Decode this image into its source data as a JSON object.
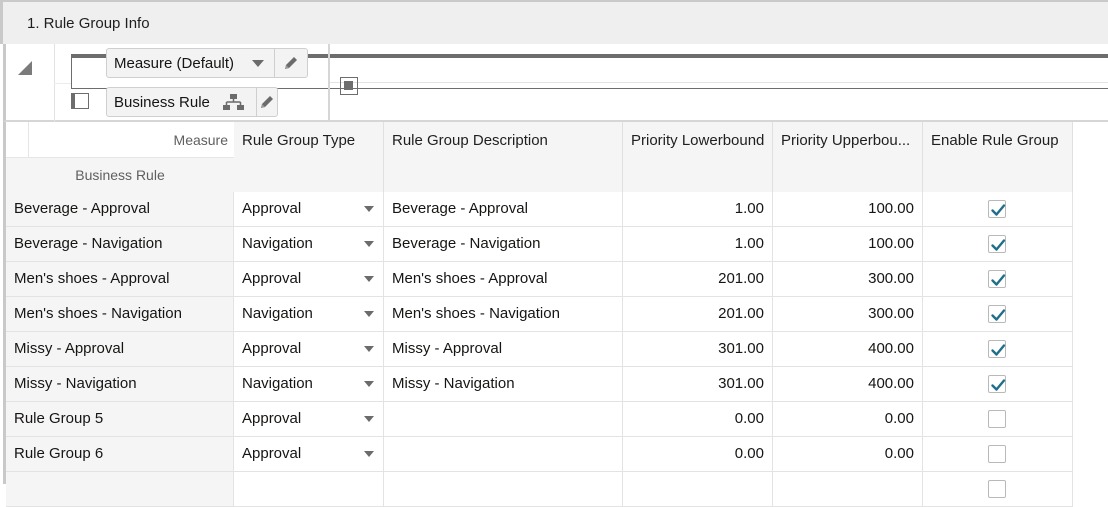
{
  "panel": {
    "title": "1. Rule Group Info"
  },
  "pivot": {
    "row_dimension": {
      "label": "Measure (Default)"
    },
    "col_dimension": {
      "label": "Business Rule"
    }
  },
  "grid": {
    "corner": {
      "measure_label": "Measure",
      "business_rule_label": "Business Rule"
    },
    "columns": [
      "Rule Group Type",
      "Rule Group Description",
      "Priority Lowerbound",
      "Priority Upperbou...",
      "Enable Rule Group"
    ],
    "rows": [
      {
        "name": "Beverage - Approval",
        "type": "Approval",
        "description": "Beverage - Approval",
        "lower": "1.00",
        "upper": "100.00",
        "enabled": true
      },
      {
        "name": "Beverage - Navigation",
        "type": "Navigation",
        "description": "Beverage - Navigation",
        "lower": "1.00",
        "upper": "100.00",
        "enabled": true
      },
      {
        "name": "Men's shoes - Approval",
        "type": "Approval",
        "description": "Men's shoes - Approval",
        "lower": "201.00",
        "upper": "300.00",
        "enabled": true
      },
      {
        "name": "Men's shoes - Navigation",
        "type": "Navigation",
        "description": "Men's shoes - Navigation",
        "lower": "201.00",
        "upper": "300.00",
        "enabled": true
      },
      {
        "name": "Missy - Approval",
        "type": "Approval",
        "description": "Missy - Approval",
        "lower": "301.00",
        "upper": "400.00",
        "enabled": true
      },
      {
        "name": "Missy - Navigation",
        "type": "Navigation",
        "description": "Missy - Navigation",
        "lower": "301.00",
        "upper": "400.00",
        "enabled": true
      },
      {
        "name": "Rule Group 5",
        "type": "Approval",
        "description": "",
        "lower": "0.00",
        "upper": "0.00",
        "enabled": false
      },
      {
        "name": "Rule Group 6",
        "type": "Approval",
        "description": "",
        "lower": "0.00",
        "upper": "0.00",
        "enabled": false
      }
    ]
  },
  "colors": {
    "check": "#1f6f8b"
  }
}
